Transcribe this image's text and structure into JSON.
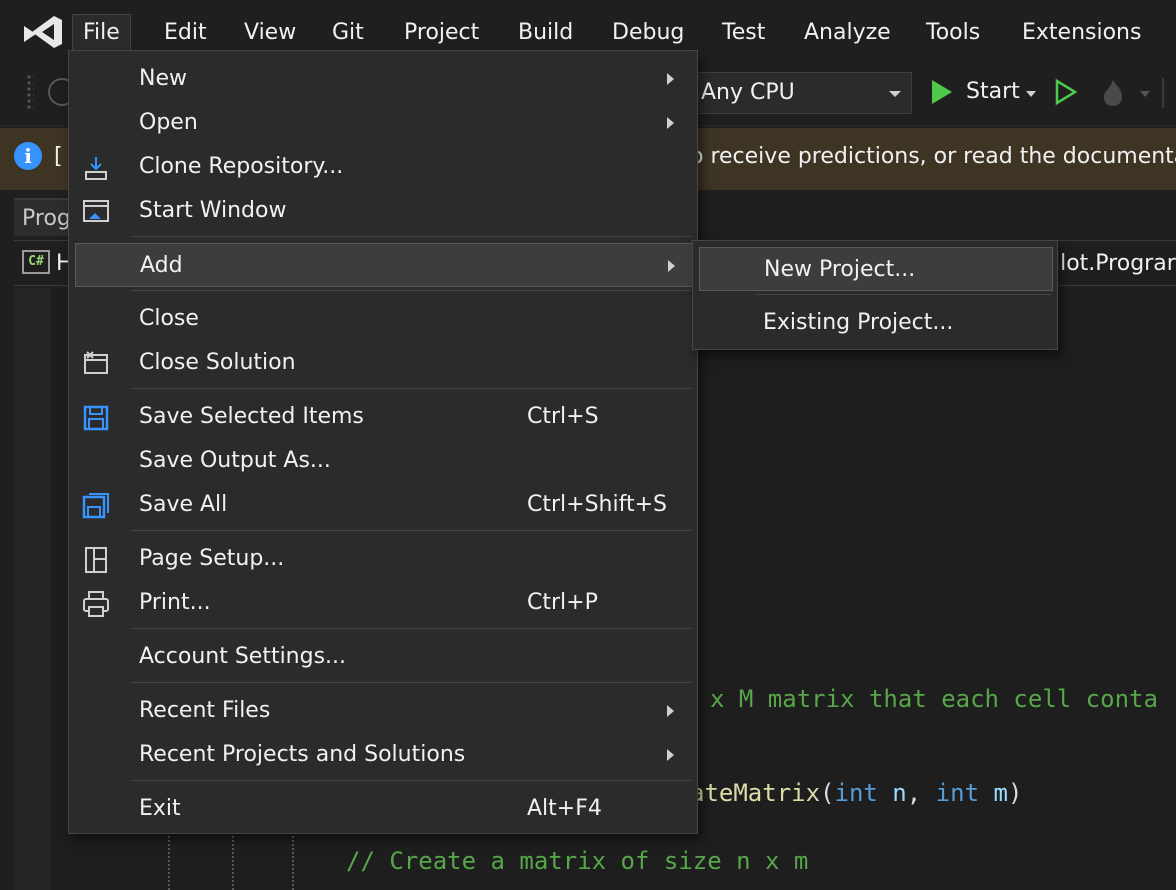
{
  "menubar": {
    "items": [
      {
        "label": "File"
      },
      {
        "label": "Edit"
      },
      {
        "label": "View"
      },
      {
        "label": "Git"
      },
      {
        "label": "Project"
      },
      {
        "label": "Build"
      },
      {
        "label": "Debug"
      },
      {
        "label": "Test"
      },
      {
        "label": "Analyze"
      },
      {
        "label": "Tools"
      },
      {
        "label": "Extensions"
      }
    ]
  },
  "toolbar": {
    "platform": "Any CPU",
    "start_label": "Start"
  },
  "infobar": {
    "bracket": "[",
    "text": "o receive predictions, or read the documentati"
  },
  "doctab": {
    "label": "Prog"
  },
  "navbar": {
    "file_abbrev": "H",
    "right_text": "ilot.Prograr",
    "cs_badge": "C#"
  },
  "code": {
    "line1": "x M matrix that each cell conta",
    "line2_fn": "ateMatrix",
    "line2_open": "(",
    "line2_kw1": "int",
    "line2_p1": " n",
    "line2_comma": ", ",
    "line2_kw2": "int",
    "line2_p2": " m",
    "line2_close": ")",
    "line3": "// Create a matrix of size n x m"
  },
  "file_menu": {
    "items": [
      {
        "label": "New",
        "shortcut": "",
        "submenu": true
      },
      {
        "label": "Open",
        "shortcut": "",
        "submenu": true
      },
      {
        "label": "Clone Repository...",
        "shortcut": "",
        "icon": "clone-icon"
      },
      {
        "label": "Start Window",
        "shortcut": "",
        "icon": "start-window-icon"
      },
      {
        "label": "Add",
        "shortcut": "",
        "submenu": true,
        "highlighted": true
      },
      {
        "label": "Close",
        "shortcut": ""
      },
      {
        "label": "Close Solution",
        "shortcut": "",
        "icon": "close-solution-icon"
      },
      {
        "label": "Save Selected Items",
        "shortcut": "Ctrl+S",
        "icon": "save-icon"
      },
      {
        "label": "Save Output As...",
        "shortcut": ""
      },
      {
        "label": "Save All",
        "shortcut": "Ctrl+Shift+S",
        "icon": "save-all-icon"
      },
      {
        "label": "Page Setup...",
        "shortcut": "",
        "icon": "page-setup-icon"
      },
      {
        "label": "Print...",
        "shortcut": "Ctrl+P",
        "icon": "print-icon"
      },
      {
        "label": "Account Settings...",
        "shortcut": ""
      },
      {
        "label": "Recent Files",
        "shortcut": "",
        "submenu": true
      },
      {
        "label": "Recent Projects and Solutions",
        "shortcut": "",
        "submenu": true
      },
      {
        "label": "Exit",
        "shortcut": "Alt+F4"
      }
    ]
  },
  "add_submenu": {
    "items": [
      {
        "label": "New Project...",
        "highlighted": true
      },
      {
        "label": "Existing Project..."
      }
    ]
  },
  "colors": {
    "accent_blue": "#3794ff",
    "play_green": "#4ec94e",
    "infobar_bg": "#3d3424"
  }
}
